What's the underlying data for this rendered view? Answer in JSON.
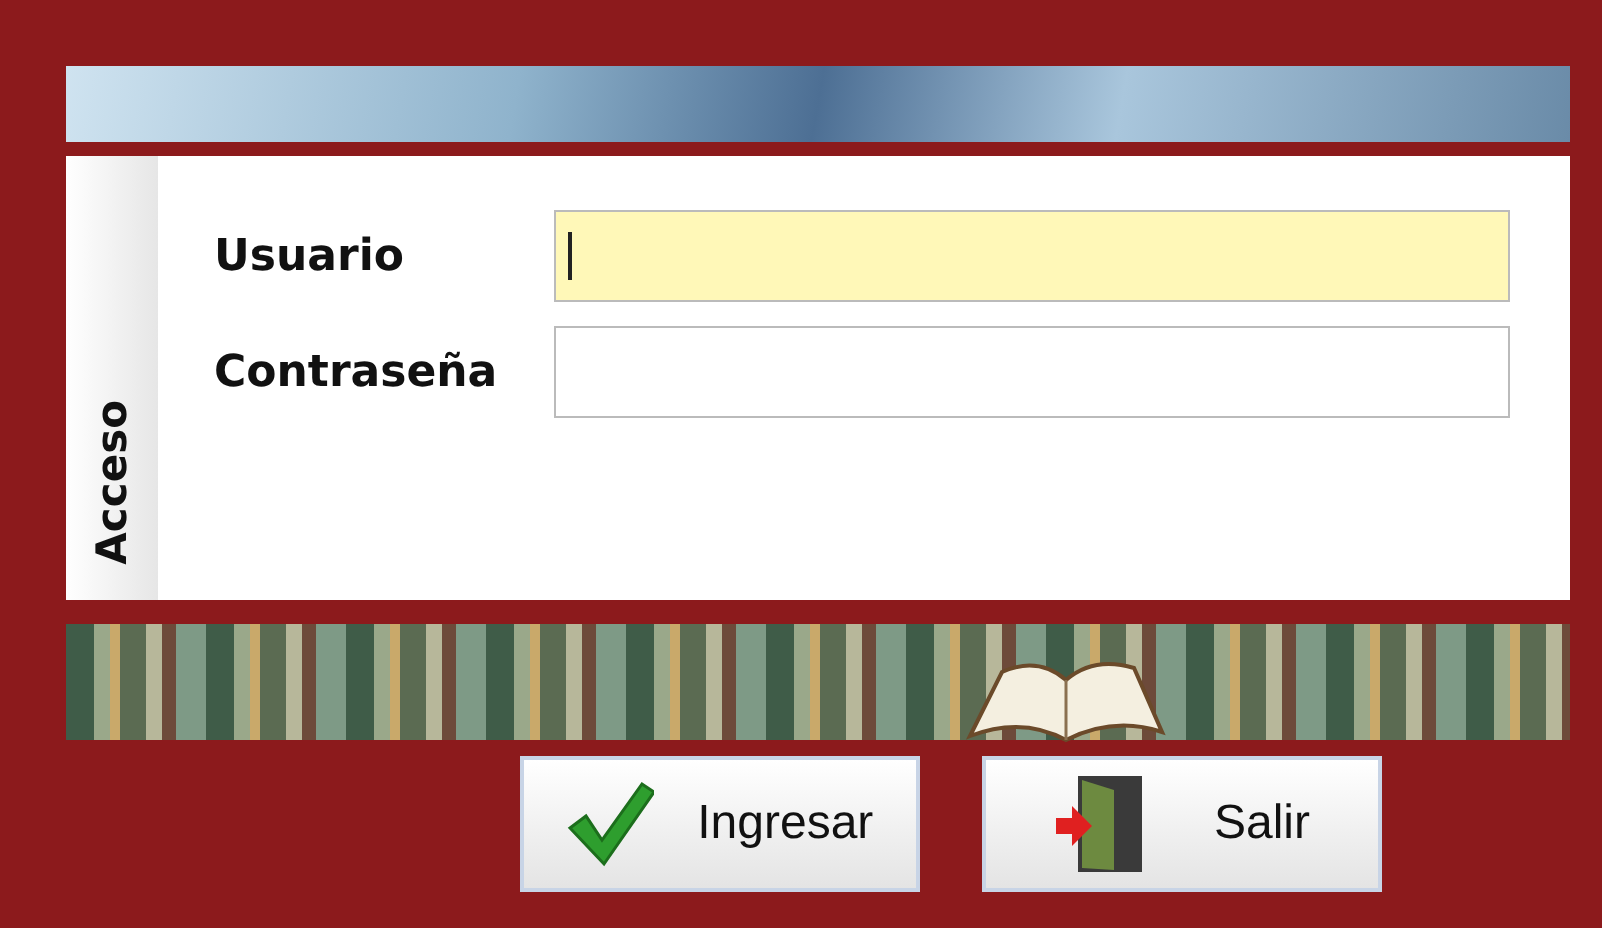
{
  "login": {
    "tab": "Acceso",
    "fields": [
      {
        "label": "Usuario",
        "focused": true
      },
      {
        "label": "Contraseña",
        "focused": false
      }
    ],
    "buttons": [
      {
        "label": "Ingresar",
        "kind": "ok"
      },
      {
        "label": "Salir",
        "kind": "exit"
      }
    ]
  }
}
